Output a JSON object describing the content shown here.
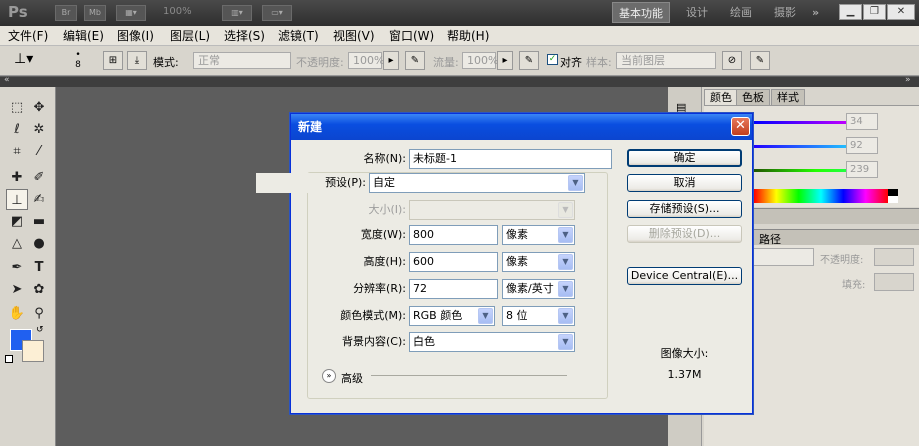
{
  "appbar": {
    "logo": "Ps",
    "zoom": "100%",
    "workspaces": [
      "基本功能",
      "设计",
      "绘画",
      "摄影",
      "»"
    ]
  },
  "menubar": {
    "items": [
      "文件(F)",
      "编辑(E)",
      "图像(I)",
      "图层(L)",
      "选择(S)",
      "滤镜(T)",
      "视图(V)",
      "窗口(W)",
      "帮助(H)"
    ]
  },
  "options": {
    "brush_size": "8",
    "mode_label": "模式:",
    "mode_value": "正常",
    "opacity_label": "不透明度:",
    "opacity_value": "100%",
    "flow_label": "流量:",
    "flow_value": "100%",
    "align_label": "对齐",
    "sample_label": "样本:",
    "sample_value": "当前图层"
  },
  "right_panel": {
    "color_tabs": [
      "颜色",
      "色板",
      "样式"
    ],
    "rgb_values": [
      "34",
      "92",
      "239"
    ],
    "layers_tab": "路径",
    "opacity_label": "不透明度:",
    "fill_label": "填充:"
  },
  "dialog": {
    "title": "新建",
    "name_label": "名称(N):",
    "name_value": "未标题-1",
    "preset_label": "预设(P):",
    "preset_value": "自定",
    "size_label": "大小(I):",
    "width_label": "宽度(W):",
    "width_value": "800",
    "width_unit": "像素",
    "height_label": "高度(H):",
    "height_value": "600",
    "height_unit": "像素",
    "resolution_label": "分辨率(R):",
    "resolution_value": "72",
    "resolution_unit": "像素/英寸",
    "color_mode_label": "颜色模式(M):",
    "color_mode_value": "RGB 颜色",
    "bit_depth_value": "8 位",
    "bg_label": "背景内容(C):",
    "bg_value": "白色",
    "advanced_label": "高级",
    "ok_label": "确定",
    "cancel_label": "取消",
    "save_preset_label": "存储预设(S)...",
    "delete_preset_label": "删除预设(D)...",
    "device_central_label": "Device Central(E)...",
    "image_size_label": "图像大小:",
    "image_size_value": "1.37M"
  },
  "colors": {
    "foreground": "#2060f0",
    "background": "#fcefd5",
    "dialog_title": "#0a4ee0"
  }
}
